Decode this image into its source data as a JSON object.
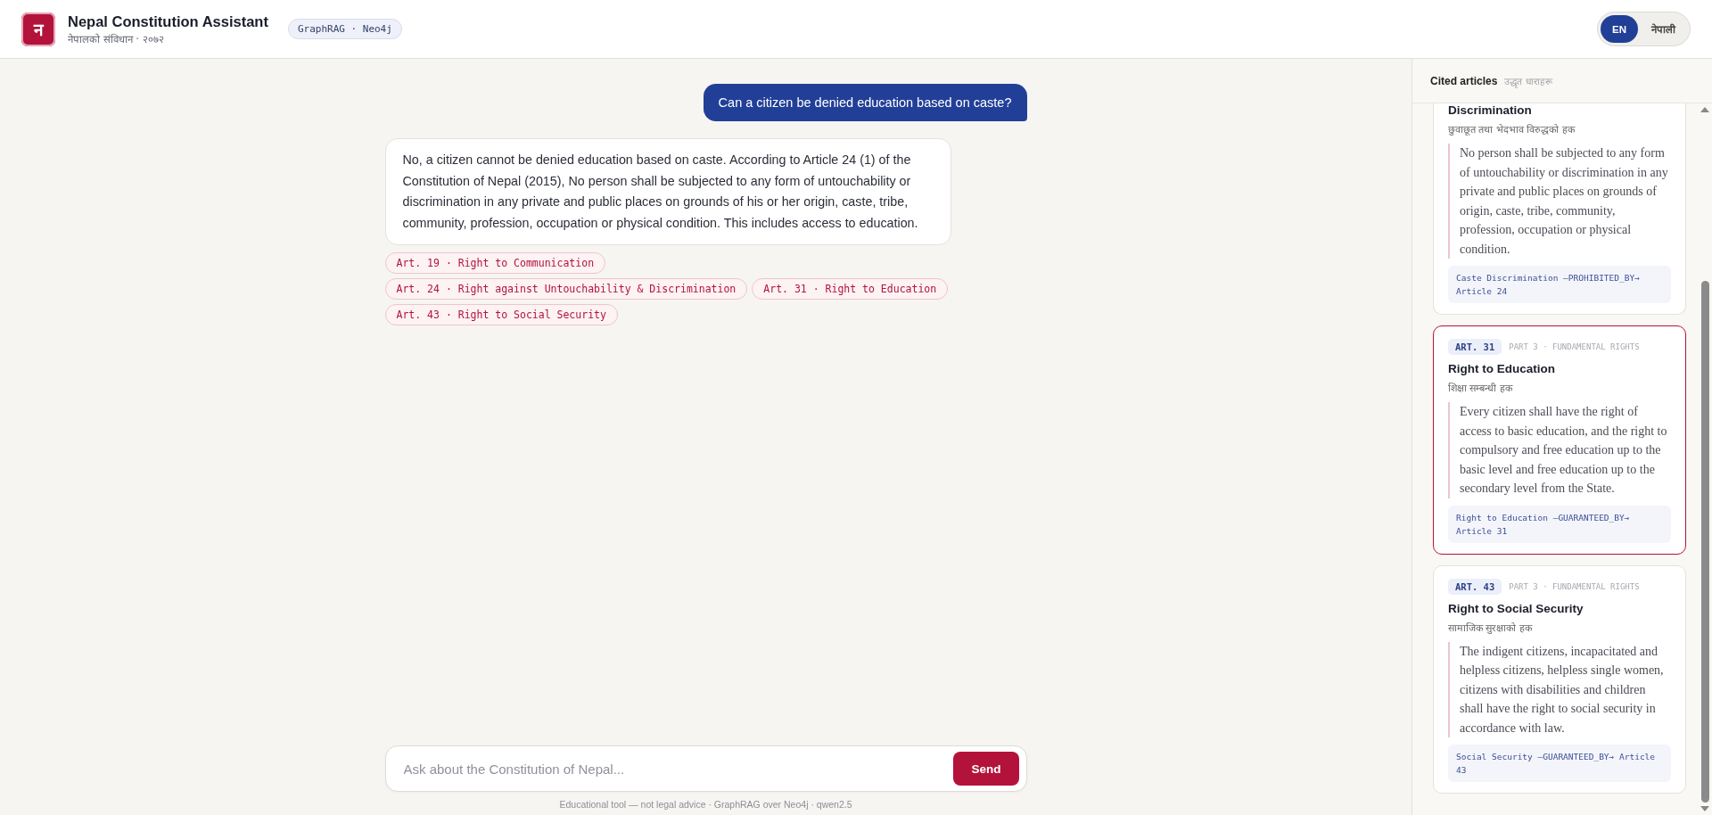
{
  "header": {
    "logo": "न",
    "title": "Nepal Constitution Assistant",
    "subtitle": "नेपालको संविधान · २०७२",
    "badge": "GraphRAG · Neo4j"
  },
  "language_toggle": [
    {
      "label": "EN",
      "selected": true
    },
    {
      "label": "नेपाली",
      "selected": false
    }
  ],
  "messages": [
    {
      "kind": "user",
      "text": "Can a citizen be denied education based on caste?"
    },
    {
      "kind": "assistant",
      "text": "No, a citizen cannot be denied education based on caste. According to Article 24 (1) of the Constitution of Nepal (2015), No person shall be subjected to any form of untouchability or discrimination in any private and public places on grounds of his or her origin, caste, tribe, community, profession, occupation or physical condition. This includes access to education."
    }
  ],
  "citations": [
    "Art. 19 · Right to Communication",
    "Art. 24 · Right against Untouchability & Discrimination",
    "Art. 31 · Right to Education",
    "Art. 43 · Right to Social Security"
  ],
  "composer": {
    "placeholder": "Ask about the Constitution of Nepal...",
    "button": "Send"
  },
  "footer": "Educational tool — not legal advice · GraphRAG over Neo4j · qwen2.5",
  "sidebar": {
    "title": "Cited articles",
    "subtitle": "उद्धृत धाराहरू",
    "cards": [
      {
        "selected": false,
        "title": "Discrimination",
        "title_np": "छुवाछूत तथा भेदभाव विरुद्धको हक",
        "quote": "No person shall be subjected to any form of untouchability or discrimination in any private and public places on grounds of origin, caste, tribe, community, profession, occupation or physical condition.",
        "relation": "Caste Discrimination —PROHIBITED_BY→ Article 24"
      },
      {
        "selected": true,
        "article": "ART. 31",
        "part": "PART 3 · FUNDAMENTAL RIGHTS",
        "title": "Right to Education",
        "title_np": "शिक्षा सम्बन्धी हक",
        "quote": "Every citizen shall have the right of access to basic education, and the right to compulsory and free education up to the basic level and free education up to the secondary level from the State.",
        "relation": "Right to Education —GUARANTEED_BY→ Article 31"
      },
      {
        "selected": false,
        "article": "ART. 43",
        "part": "PART 3 · FUNDAMENTAL RIGHTS",
        "title": "Right to Social Security",
        "title_np": "सामाजिक सुरक्षाको हक",
        "quote": "The indigent citizens, incapacitated and helpless citizens, helpless single women, citizens with disabilities and children shall have the right to social security in accordance with law.",
        "relation": "Social Security —GUARANTEED_BY→ Article 43"
      }
    ]
  }
}
